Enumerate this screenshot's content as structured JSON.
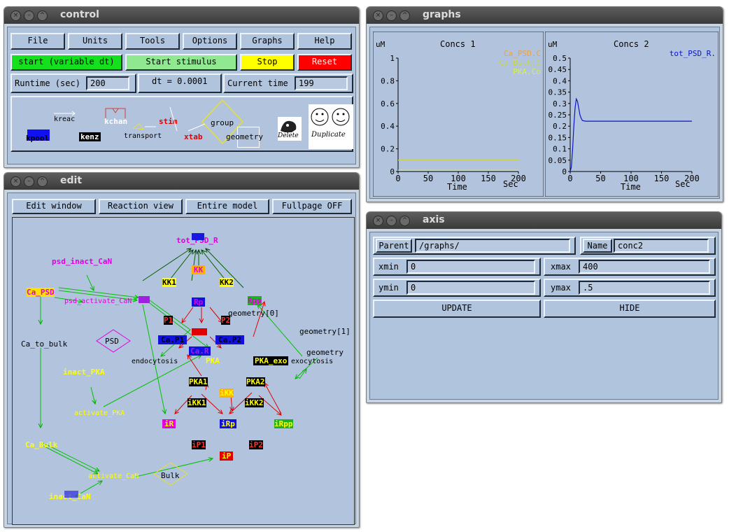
{
  "control": {
    "title": "control",
    "menu": [
      "File",
      "Units",
      "Tools",
      "Options",
      "Graphs",
      "Help"
    ],
    "start_label": "start (variable dt)",
    "stimulus_label": "Start stimulus",
    "stop_label": "Stop",
    "reset_label": "Reset",
    "runtime_label": "Runtime (sec)",
    "runtime_value": "200",
    "dt_label": "dt = 0.0001",
    "current_time_label": "Current time",
    "current_time_value": "199",
    "tools": {
      "kreac": "kreac",
      "kchan": "kchan",
      "stim": "stim",
      "group": "group",
      "kpool": "kpool",
      "kenz": "kenz",
      "transport": "transport",
      "xtab": "xtab",
      "geometry": "geometry",
      "delete": "Delete",
      "duplicate": "Duplicate"
    }
  },
  "graphs": {
    "title": "graphs",
    "plot1": {
      "title": "Concs 1",
      "yunit": "uM",
      "xlabel": "Time",
      "xunit": "Sec",
      "yticks": [
        "1",
        "0.8",
        "0.6",
        "0.4",
        "0.2",
        "0"
      ],
      "xticks": [
        "0",
        "50",
        "100",
        "150",
        "200"
      ],
      "legend": [
        "Ca_PSD.C",
        "Ca_Bulk.C",
        "PKA.Co"
      ]
    },
    "plot2": {
      "title": "Concs 2",
      "yunit": "uM",
      "xlabel": "Time",
      "xunit": "Sec",
      "yticks": [
        "0.5",
        "0.45",
        "0.4",
        "0.35",
        "0.3",
        "0.25",
        "0.2",
        "0.15",
        "0.1",
        "0.05",
        "0"
      ],
      "xticks": [
        "0",
        "50",
        "100",
        "150",
        "200"
      ],
      "legend": [
        "tot_PSD_R."
      ]
    }
  },
  "chart_data": [
    {
      "type": "line",
      "title": "Concs 1",
      "ylabel": "uM",
      "xlabel": "Time",
      "xunit": "Sec",
      "xlim": [
        0,
        200
      ],
      "ylim": [
        0,
        1
      ],
      "series": [
        {
          "name": "Ca_PSD.C",
          "color": "#f0a040",
          "x": [
            0,
            200
          ],
          "y": [
            0.1,
            0.1
          ]
        },
        {
          "name": "Ca_Bulk.C",
          "color": "#c8d840",
          "x": [
            0,
            200
          ],
          "y": [
            0.1,
            0.1
          ]
        },
        {
          "name": "PKA.Co",
          "color": "#d8f040",
          "x": [
            0,
            200
          ],
          "y": [
            0.01,
            0.01
          ]
        }
      ]
    },
    {
      "type": "line",
      "title": "Concs 2",
      "ylabel": "uM",
      "xlabel": "Time",
      "xunit": "Sec",
      "xlim": [
        0,
        200
      ],
      "ylim": [
        0,
        0.5
      ],
      "series": [
        {
          "name": "tot_PSD_R.",
          "color": "#0a14c8",
          "x": [
            0,
            2,
            4,
            6,
            8,
            10,
            12,
            14,
            16,
            18,
            20,
            25,
            30,
            40,
            60,
            100,
            150,
            200
          ],
          "y": [
            0,
            0.02,
            0.1,
            0.2,
            0.28,
            0.32,
            0.31,
            0.28,
            0.25,
            0.235,
            0.225,
            0.222,
            0.222,
            0.222,
            0.222,
            0.222,
            0.222,
            0.222
          ]
        }
      ]
    }
  ],
  "axis": {
    "title": "axis",
    "parent_label": "Parent",
    "parent_value": "/graphs/",
    "name_label": "Name",
    "name_value": "conc2",
    "xmin_label": "xmin",
    "xmin_value": "0",
    "xmax_label": "xmax",
    "xmax_value": "400",
    "ymin_label": "ymin",
    "ymin_value": "0",
    "ymax_label": "ymax",
    "ymax_value": ".5",
    "update_label": "UPDATE",
    "hide_label": "HIDE"
  },
  "edit": {
    "title": "edit",
    "buttons": [
      "Edit window",
      "Reaction view",
      "Entire model",
      "Fullpage OFF"
    ],
    "nodes": {
      "tot_psd_r": "tot_PSD_R",
      "psd_inact": "psd_inact_CaN",
      "ca_psd": "Ca_PSD",
      "psd_activate": "psd_activate_CaN",
      "kk": "KK",
      "kk1": "KK1",
      "kk2": "KK2",
      "rp": "Rp",
      "rpp": "Rpp",
      "geometry0": "geometry[0]",
      "p1": "P1",
      "p2": "P2",
      "ca_to_bulk": "Ca_to_bulk",
      "psd": "PSD",
      "ca_p1": "Ca.P1",
      "ca_p2": "Ca.P2",
      "ca_r": "Ca.R",
      "geometry1": "geometry[1]",
      "geometry": "geometry",
      "endocytosis": "endocytosis",
      "pka": "PKA",
      "pka_exo": "PKA_exo",
      "exocytosis": "exocytosis",
      "inact_pka": "inact_PKA",
      "pka1": "PKA1",
      "pka2": "PKA2",
      "ikk": "iKK",
      "ikk1": "iKK1",
      "ikk2": "iKK2",
      "activate_pka": "activate_PKA",
      "ir": "iR",
      "irp": "iRp",
      "irpp": "iRpp",
      "ca_bulk": "Ca_Bulk",
      "ip1": "iP1",
      "ip2": "iP2",
      "ip": "iP",
      "activate_can": "activate_CaN",
      "bulk": "Bulk",
      "inact_can": "inact_CaN"
    }
  }
}
